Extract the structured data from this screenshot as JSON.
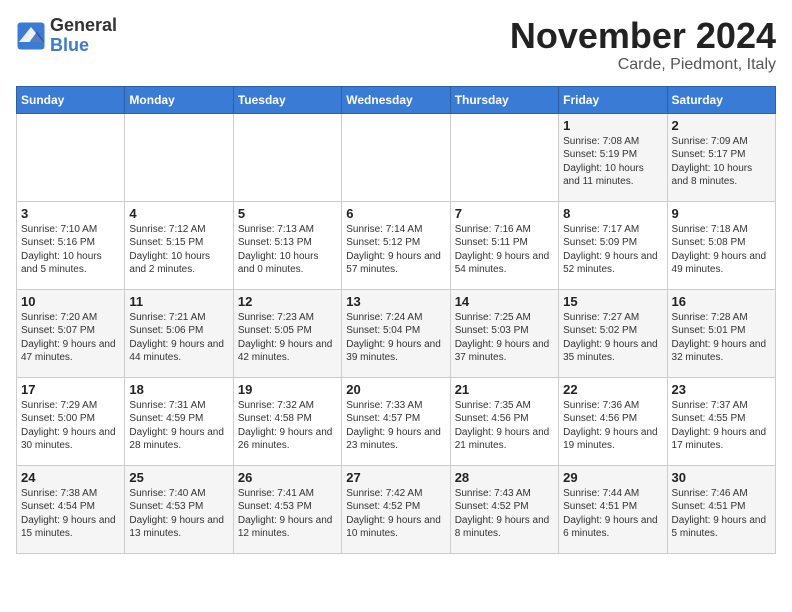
{
  "logo": {
    "general": "General",
    "blue": "Blue"
  },
  "title": "November 2024",
  "location": "Carde, Piedmont, Italy",
  "days_of_week": [
    "Sunday",
    "Monday",
    "Tuesday",
    "Wednesday",
    "Thursday",
    "Friday",
    "Saturday"
  ],
  "weeks": [
    [
      {
        "day": "",
        "info": ""
      },
      {
        "day": "",
        "info": ""
      },
      {
        "day": "",
        "info": ""
      },
      {
        "day": "",
        "info": ""
      },
      {
        "day": "",
        "info": ""
      },
      {
        "day": "1",
        "info": "Sunrise: 7:08 AM\nSunset: 5:19 PM\nDaylight: 10 hours and 11 minutes."
      },
      {
        "day": "2",
        "info": "Sunrise: 7:09 AM\nSunset: 5:17 PM\nDaylight: 10 hours and 8 minutes."
      }
    ],
    [
      {
        "day": "3",
        "info": "Sunrise: 7:10 AM\nSunset: 5:16 PM\nDaylight: 10 hours and 5 minutes."
      },
      {
        "day": "4",
        "info": "Sunrise: 7:12 AM\nSunset: 5:15 PM\nDaylight: 10 hours and 2 minutes."
      },
      {
        "day": "5",
        "info": "Sunrise: 7:13 AM\nSunset: 5:13 PM\nDaylight: 10 hours and 0 minutes."
      },
      {
        "day": "6",
        "info": "Sunrise: 7:14 AM\nSunset: 5:12 PM\nDaylight: 9 hours and 57 minutes."
      },
      {
        "day": "7",
        "info": "Sunrise: 7:16 AM\nSunset: 5:11 PM\nDaylight: 9 hours and 54 minutes."
      },
      {
        "day": "8",
        "info": "Sunrise: 7:17 AM\nSunset: 5:09 PM\nDaylight: 9 hours and 52 minutes."
      },
      {
        "day": "9",
        "info": "Sunrise: 7:18 AM\nSunset: 5:08 PM\nDaylight: 9 hours and 49 minutes."
      }
    ],
    [
      {
        "day": "10",
        "info": "Sunrise: 7:20 AM\nSunset: 5:07 PM\nDaylight: 9 hours and 47 minutes."
      },
      {
        "day": "11",
        "info": "Sunrise: 7:21 AM\nSunset: 5:06 PM\nDaylight: 9 hours and 44 minutes."
      },
      {
        "day": "12",
        "info": "Sunrise: 7:23 AM\nSunset: 5:05 PM\nDaylight: 9 hours and 42 minutes."
      },
      {
        "day": "13",
        "info": "Sunrise: 7:24 AM\nSunset: 5:04 PM\nDaylight: 9 hours and 39 minutes."
      },
      {
        "day": "14",
        "info": "Sunrise: 7:25 AM\nSunset: 5:03 PM\nDaylight: 9 hours and 37 minutes."
      },
      {
        "day": "15",
        "info": "Sunrise: 7:27 AM\nSunset: 5:02 PM\nDaylight: 9 hours and 35 minutes."
      },
      {
        "day": "16",
        "info": "Sunrise: 7:28 AM\nSunset: 5:01 PM\nDaylight: 9 hours and 32 minutes."
      }
    ],
    [
      {
        "day": "17",
        "info": "Sunrise: 7:29 AM\nSunset: 5:00 PM\nDaylight: 9 hours and 30 minutes."
      },
      {
        "day": "18",
        "info": "Sunrise: 7:31 AM\nSunset: 4:59 PM\nDaylight: 9 hours and 28 minutes."
      },
      {
        "day": "19",
        "info": "Sunrise: 7:32 AM\nSunset: 4:58 PM\nDaylight: 9 hours and 26 minutes."
      },
      {
        "day": "20",
        "info": "Sunrise: 7:33 AM\nSunset: 4:57 PM\nDaylight: 9 hours and 23 minutes."
      },
      {
        "day": "21",
        "info": "Sunrise: 7:35 AM\nSunset: 4:56 PM\nDaylight: 9 hours and 21 minutes."
      },
      {
        "day": "22",
        "info": "Sunrise: 7:36 AM\nSunset: 4:56 PM\nDaylight: 9 hours and 19 minutes."
      },
      {
        "day": "23",
        "info": "Sunrise: 7:37 AM\nSunset: 4:55 PM\nDaylight: 9 hours and 17 minutes."
      }
    ],
    [
      {
        "day": "24",
        "info": "Sunrise: 7:38 AM\nSunset: 4:54 PM\nDaylight: 9 hours and 15 minutes."
      },
      {
        "day": "25",
        "info": "Sunrise: 7:40 AM\nSunset: 4:53 PM\nDaylight: 9 hours and 13 minutes."
      },
      {
        "day": "26",
        "info": "Sunrise: 7:41 AM\nSunset: 4:53 PM\nDaylight: 9 hours and 12 minutes."
      },
      {
        "day": "27",
        "info": "Sunrise: 7:42 AM\nSunset: 4:52 PM\nDaylight: 9 hours and 10 minutes."
      },
      {
        "day": "28",
        "info": "Sunrise: 7:43 AM\nSunset: 4:52 PM\nDaylight: 9 hours and 8 minutes."
      },
      {
        "day": "29",
        "info": "Sunrise: 7:44 AM\nSunset: 4:51 PM\nDaylight: 9 hours and 6 minutes."
      },
      {
        "day": "30",
        "info": "Sunrise: 7:46 AM\nSunset: 4:51 PM\nDaylight: 9 hours and 5 minutes."
      }
    ]
  ]
}
